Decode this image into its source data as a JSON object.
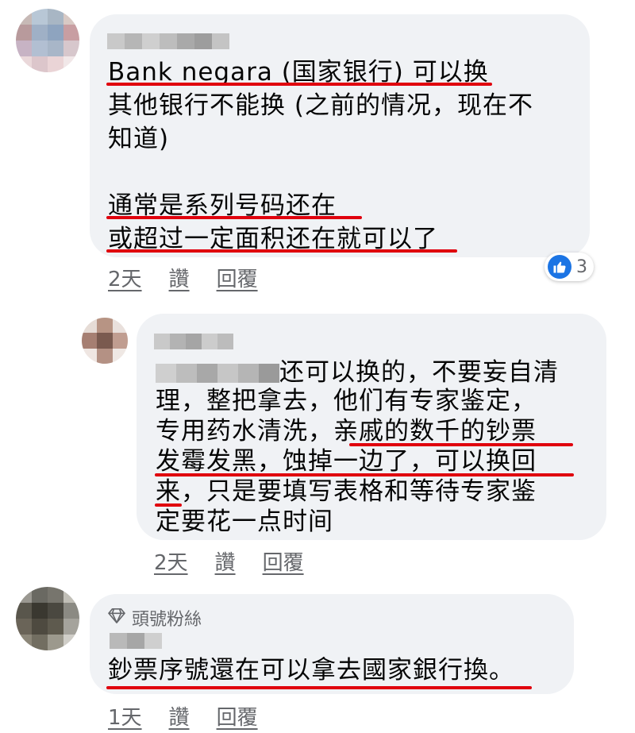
{
  "comments": [
    {
      "lines": [
        "Bank negara (国家银行) 可以换",
        "其他银行不能换 (之前的情况，现在不",
        "知道)",
        "",
        "通常是系列号码还在",
        "或超过一定面积还在就可以了"
      ],
      "time": "2天",
      "like_label": "讚",
      "reply_label": "回覆",
      "reaction_count": "3"
    },
    {
      "lines": [
        "还可以换的，不要妄自清",
        "理，整把拿去，他们有专家鉴定，",
        "专用药水清洗，亲戚的数千的钞票",
        "发霉发黑，蚀掉一边了，可以换回",
        "来，只是要填写表格和等待专家鉴",
        "定要花一点时间"
      ],
      "time": "2天",
      "like_label": "讚",
      "reply_label": "回覆"
    },
    {
      "badge": "頭號粉絲",
      "lines": [
        "鈔票序號還在可以拿去國家銀行換。"
      ],
      "time": "1天",
      "like_label": "讚",
      "reply_label": "回覆"
    }
  ],
  "icons": {
    "reaction": "like-icon",
    "badge": "diamond-icon"
  },
  "colors": {
    "bubble": "#f0f2f5",
    "underline": "#e0000d",
    "like": "#1b74e4",
    "meta_text": "#65676b"
  }
}
